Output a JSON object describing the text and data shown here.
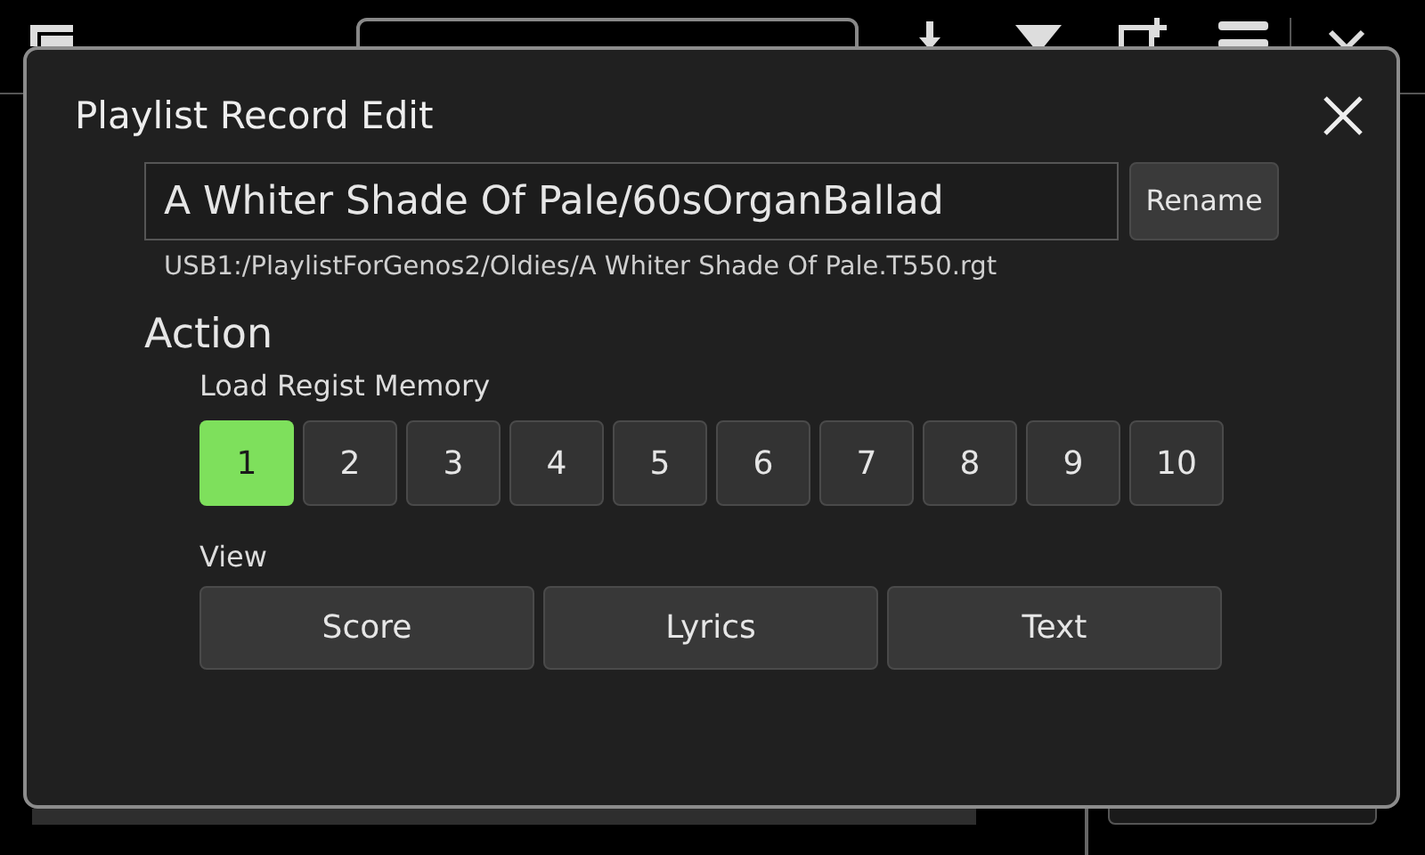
{
  "dialog": {
    "title": "Playlist Record Edit",
    "name_field": {
      "value": "A Whiter Shade Of Pale/60sOrganBallad"
    },
    "rename_button": "Rename",
    "path": "USB1:/PlaylistForGenos2/Oldies/A Whiter Shade Of Pale.T550.rgt",
    "section": "Action",
    "regist_label": "Load Regist Memory",
    "regist_buttons": [
      {
        "label": "1",
        "selected": true
      },
      {
        "label": "2",
        "selected": false
      },
      {
        "label": "3",
        "selected": false
      },
      {
        "label": "4",
        "selected": false
      },
      {
        "label": "5",
        "selected": false
      },
      {
        "label": "6",
        "selected": false
      },
      {
        "label": "7",
        "selected": false
      },
      {
        "label": "8",
        "selected": false
      },
      {
        "label": "9",
        "selected": false
      },
      {
        "label": "10",
        "selected": false
      }
    ],
    "view_label": "View",
    "view_buttons": [
      {
        "label": "Score"
      },
      {
        "label": "Lyrics"
      },
      {
        "label": "Text"
      }
    ]
  }
}
